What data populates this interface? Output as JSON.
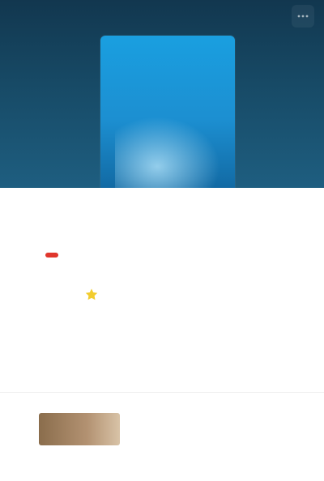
{
  "header": {
    "title": "",
    "menu_icon": "more-icon"
  },
  "hero": {
    "art_icon": "cover-art"
  },
  "content": {
    "title": "",
    "subtitle": "",
    "rating_badge": "",
    "meta": "",
    "author_icon": "star-icon",
    "author_name": "",
    "author_sub": "",
    "info_line_1": "",
    "info_line_2": ""
  },
  "related": {
    "title": "",
    "subtitle": "",
    "caption": ""
  },
  "colors": {
    "hero_dark": "#12374f",
    "hero_art": "#1a9fe0",
    "badge": "#e0362c",
    "author_star": "#f2cc2e"
  }
}
